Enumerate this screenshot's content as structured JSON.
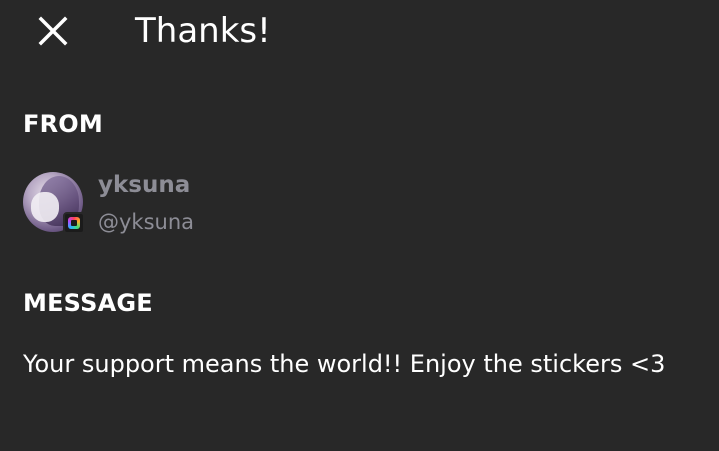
{
  "header": {
    "close_icon": "close-icon",
    "title": "Thanks!"
  },
  "from": {
    "label": "FROM",
    "display_name": "yksuna",
    "handle": "@yksuna",
    "badge_icon": "supporter-badge-icon"
  },
  "message": {
    "label": "MESSAGE",
    "text": "Your support means the world!! Enjoy the stickers <3"
  },
  "colors": {
    "background": "#282828",
    "text": "#ffffff",
    "muted": "#8d8d96"
  }
}
